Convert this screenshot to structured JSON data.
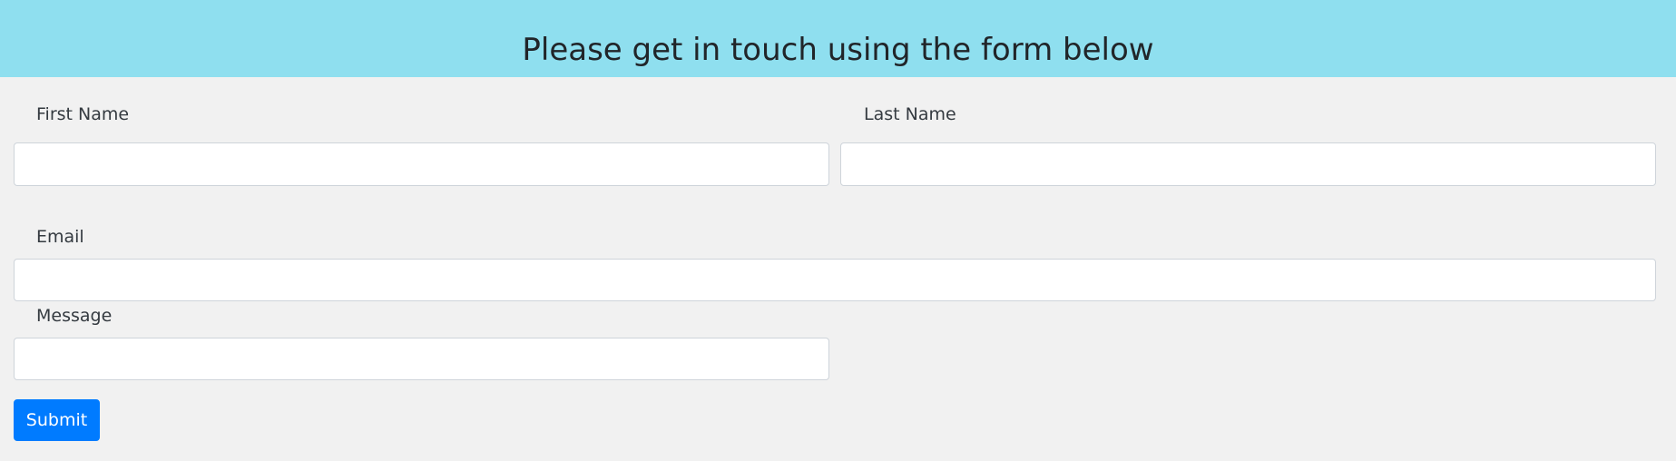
{
  "header": {
    "title": "Please get in touch using the form below"
  },
  "form": {
    "first_name": {
      "label": "First Name",
      "value": "",
      "placeholder": ""
    },
    "last_name": {
      "label": "Last Name",
      "value": "",
      "placeholder": ""
    },
    "email": {
      "label": "Email",
      "value": "",
      "placeholder": ""
    },
    "message": {
      "label": "Message",
      "value": "",
      "placeholder": ""
    },
    "submit_label": "Submit"
  },
  "colors": {
    "header_background": "#8fdfef",
    "page_background": "#f2f2f2",
    "button_primary": "#007bff"
  }
}
